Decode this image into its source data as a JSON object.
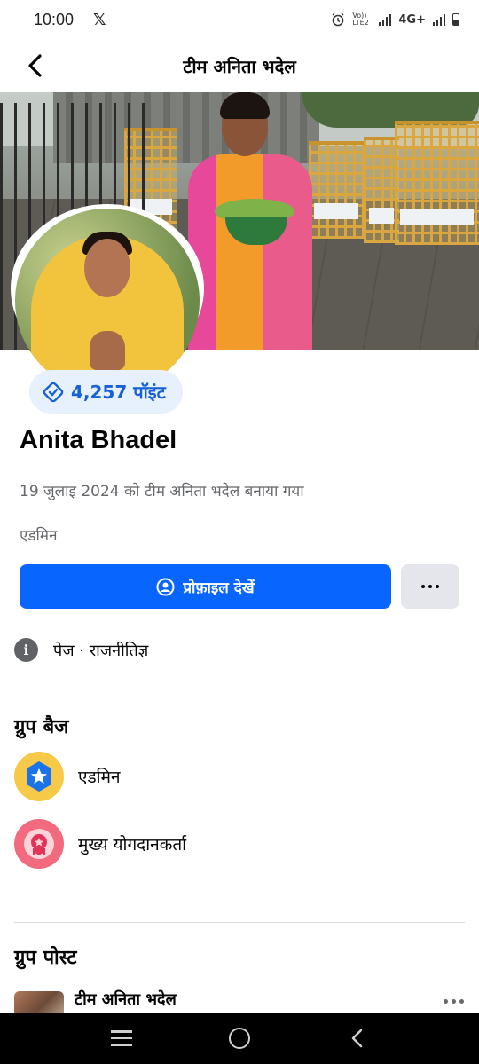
{
  "status_bar": {
    "time": "10:00",
    "app_icon": "x-logo-icon",
    "network_label": "4G+",
    "volte_label": "Vo)) LTE2",
    "icons": [
      "alarm-icon",
      "signal-icon",
      "battery-icon"
    ]
  },
  "header": {
    "title": "टीम अनिता भदेल",
    "back_icon": "back-arrow-icon"
  },
  "profile": {
    "points": "4,257 पॉइंट",
    "name": "Anita Bhadel",
    "joined": "19 जुलाइ 2024 को टीम अनिता भदेल बनाया गया",
    "role": "एडमिन",
    "view_profile_label": "प्रोफ़ाइल देखें",
    "page_info": "पेज · राजनीतिज्ञ"
  },
  "badges": {
    "title": "ग्रुप बैज",
    "items": [
      {
        "label": "एडमिन",
        "icon": "admin-star-badge-icon"
      },
      {
        "label": "मुख्य योगदानकर्ता",
        "icon": "top-contributor-badge-icon"
      }
    ]
  },
  "posts": {
    "title": "ग्रुप पोस्ट",
    "first_author": "टीम अनिता भदेल"
  },
  "colors": {
    "primary_button": "#0866ff",
    "points_text": "#1761d6",
    "points_bg": "#e7f0fd",
    "admin_badge": "#f7c948",
    "contributor_badge": "#f26a7d"
  }
}
